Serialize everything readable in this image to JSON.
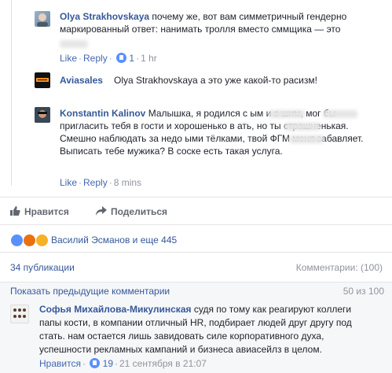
{
  "comments": [
    {
      "author": "Olya Strakhovskaya",
      "text": "почему же, вот вам симметричный гендерно маркированный ответ: нанимать тролля вместо сммщика — это",
      "meta": {
        "like": "Like",
        "reply": "Reply",
        "likes_count": "1",
        "time": "1 hr"
      }
    },
    {
      "author": "Aviasales",
      "text": "Olya Strakhovskaya а это уже какой-то расизм!"
    },
    {
      "author": "Konstantin Kalinov",
      "text": "Малышка, я родился с    ым и с    шим, мог бы пригласить тебя в гости и хорошенько в    ать, но ты страшненькая. Смешно наблюдать за недо    ыми тёлками, твой ФГМ меня забавляет. Выписать тебе мужика? В соске есть такая услуга.",
      "meta": {
        "like": "Like",
        "reply": "Reply",
        "time": "8 mins"
      }
    }
  ],
  "actions": {
    "like": "Нравится",
    "share": "Поделиться"
  },
  "reactions": {
    "text": "Василий Эсманов и еще 445"
  },
  "stats": {
    "shares": "34 публикации",
    "comments": "Комментарии: (100)"
  },
  "previous": {
    "label": "Показать предыдущие комментарии",
    "count": "50 из 100"
  },
  "bottom_comment": {
    "author": "Софья Михайлова-Микулинская",
    "text": "судя по тому как реагируют коллеги папы кости, в компании отличный HR, подбирает людей друг другу под стать. нам остается лишь завидовать силе корпоративного духа, успешности рекламных кампаний и бизнеса авиасейлз в целом.",
    "like": "Нравится",
    "likes_count": "19",
    "time": "21 сентября в 21:07"
  }
}
